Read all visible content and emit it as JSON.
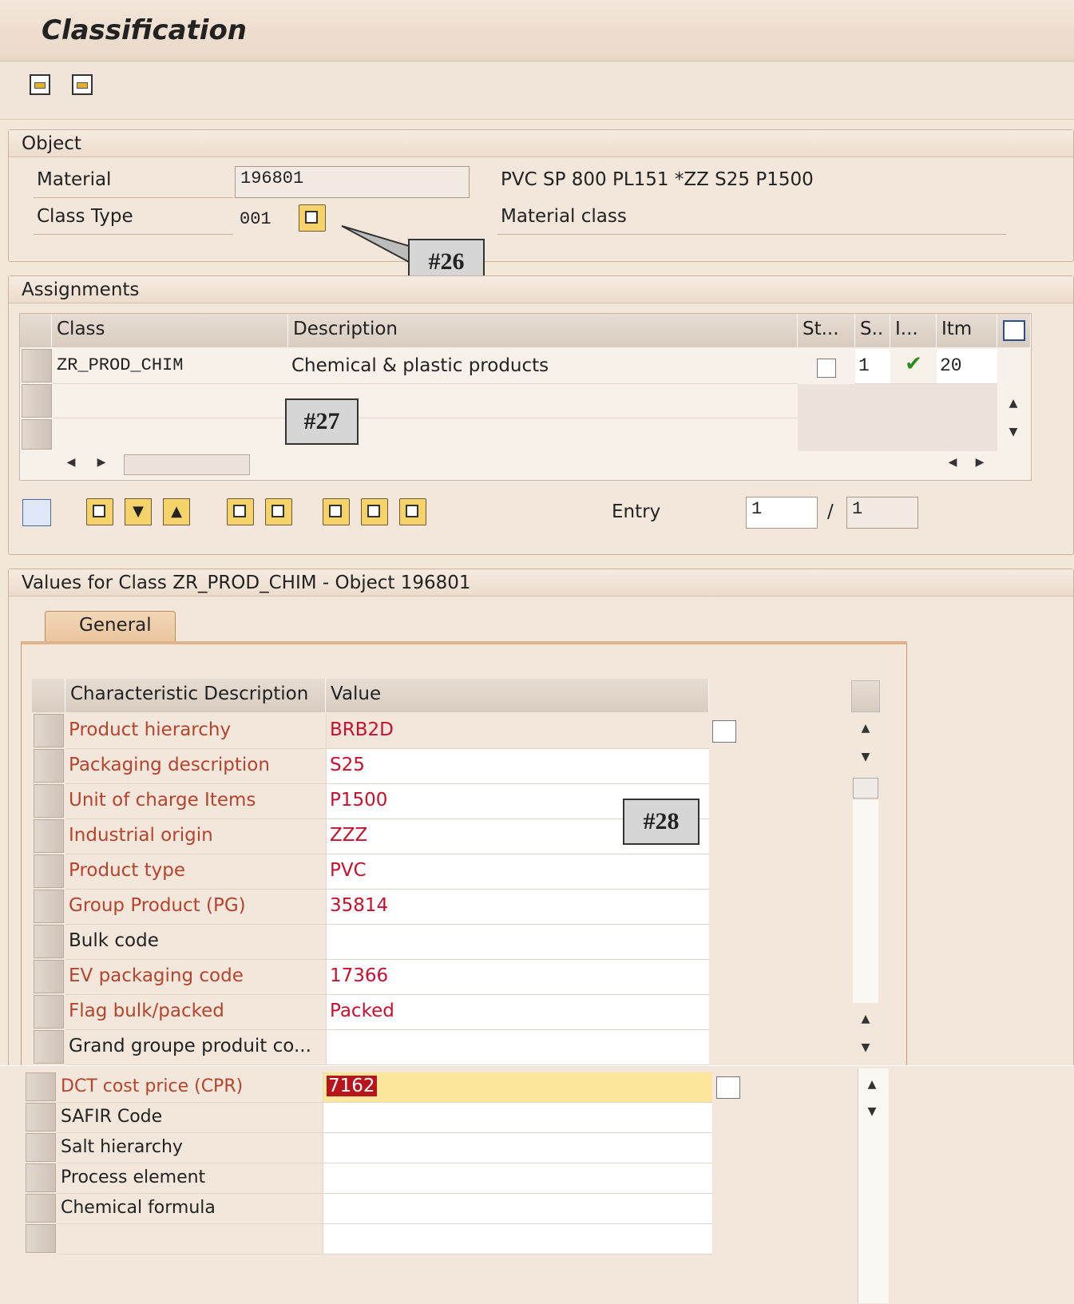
{
  "window": {
    "title": "Classification"
  },
  "toolbar": {
    "items": [
      {
        "icon": "back-icon"
      },
      {
        "icon": "forward-icon"
      }
    ]
  },
  "object": {
    "header": "Object",
    "material_label": "Material",
    "material_value": "196801",
    "material_desc": "PVC SP 800 PL151 *ZZ S25 P1500",
    "class_type_label": "Class Type",
    "class_type_value": "001",
    "class_type_desc": "Material class"
  },
  "callouts": {
    "c26": "#26",
    "c27": "#27",
    "c28": "#28"
  },
  "assignments": {
    "header": "Assignments",
    "columns": {
      "class": "Class",
      "description": "Description",
      "status": "St...",
      "s": "S..",
      "i": "I...",
      "itm": "Itm"
    },
    "rows": [
      {
        "class": "ZR_PROD_CHIM",
        "description": "Chemical & plastic products",
        "status_checked": false,
        "s": "1",
        "i": "✔",
        "itm": "20"
      }
    ],
    "entry_label": "Entry",
    "entry_value": "1",
    "entry_sep": "/",
    "entry_total": "1"
  },
  "values": {
    "header": "Values for Class ZR_PROD_CHIM - Object 196801",
    "tab_general": "General",
    "columns": {
      "desc": "Characteristic Description",
      "value": "Value"
    },
    "rows": [
      {
        "desc": "Product hierarchy",
        "value": "BRB2D"
      },
      {
        "desc": "Packaging description",
        "value": "S25"
      },
      {
        "desc": "Unit of charge Items",
        "value": "P1500"
      },
      {
        "desc": "Industrial origin",
        "value": "ZZZ"
      },
      {
        "desc": "Product type",
        "value": "PVC"
      },
      {
        "desc": "Group Product (PG)",
        "value": "35814"
      },
      {
        "desc": "Bulk code",
        "value": ""
      },
      {
        "desc": "EV packaging code",
        "value": "17366"
      },
      {
        "desc": "Flag bulk/packed",
        "value": "Packed"
      },
      {
        "desc": "Grand groupe produit co...",
        "value": ""
      }
    ],
    "rows2": [
      {
        "desc": "DCT cost price (CPR)",
        "value": "7162"
      },
      {
        "desc": "SAFIR Code",
        "value": ""
      },
      {
        "desc": "Salt hierarchy",
        "value": ""
      },
      {
        "desc": "Process element",
        "value": ""
      },
      {
        "desc": "Chemical formula",
        "value": ""
      },
      {
        "desc": "",
        "value": ""
      }
    ]
  },
  "colors": {
    "background": "#f2e6d9",
    "required_text": "#c8102e",
    "highlight": "#fbe69b"
  }
}
